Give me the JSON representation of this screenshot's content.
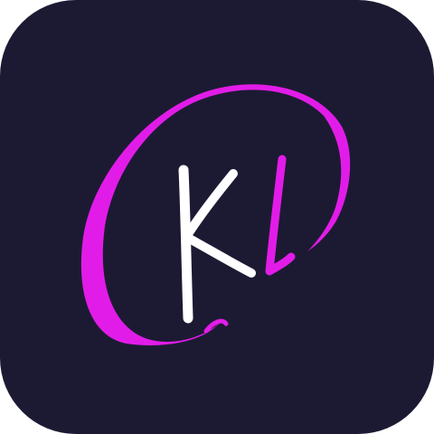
{
  "app_icon": {
    "logo_text": "KV",
    "colors": {
      "background": "#1c1a33",
      "swash": "#e21ce8",
      "letter_k": "#ffffff",
      "letter_v": "#e21ce8"
    }
  }
}
